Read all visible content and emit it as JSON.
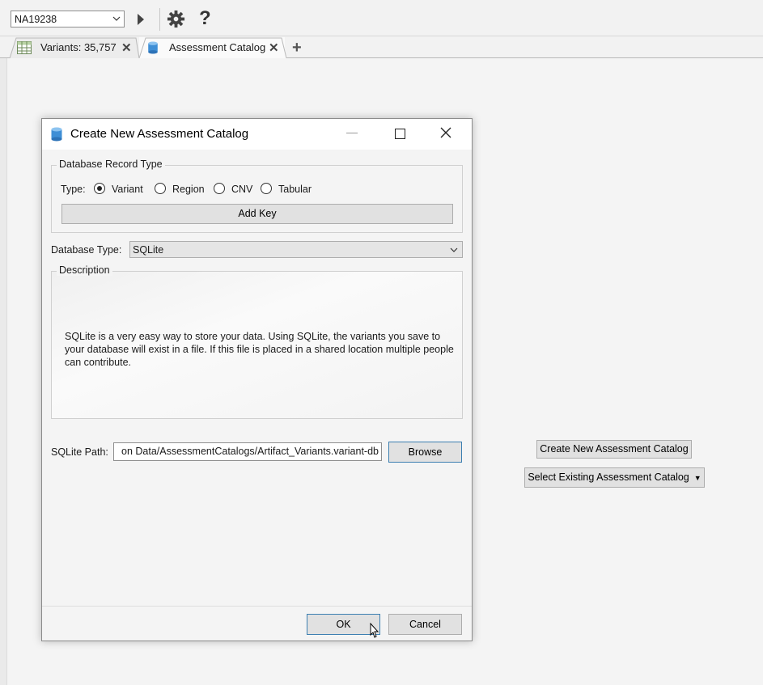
{
  "toolbar": {
    "sample_value": "NA19238",
    "icons": [
      "play-icon",
      "gear-icon",
      "help-icon"
    ],
    "help_label": "?"
  },
  "tabs": [
    {
      "label": "Variants: 35,757",
      "icon": "table-icon"
    },
    {
      "label": "Assessment Catalog",
      "icon": "database-icon",
      "active": true
    }
  ],
  "tab_add_label": "+",
  "main": {
    "create_button": "Create New Assessment Catalog",
    "select_button": "Select Existing Assessment Catalog"
  },
  "dialog": {
    "title": "Create New Assessment Catalog",
    "record_group": {
      "legend": "Database Record Type",
      "type_label": "Type:",
      "options": [
        "Variant",
        "Region",
        "CNV",
        "Tabular"
      ],
      "selected": "Variant",
      "add_key_label": "Add Key"
    },
    "db_type": {
      "label": "Database Type:",
      "value": "SQLite"
    },
    "description": {
      "legend": "Description",
      "text": "SQLite is a very easy way to store your data. Using SQLite, the variants you save to your database will exist in a file. If this file is placed in a shared location multiple people can contribute."
    },
    "path": {
      "label": "SQLite Path:",
      "value": "on Data/AssessmentCatalogs/Artifact_Variants.variant-db",
      "browse_label": "Browse"
    },
    "ok_label": "OK",
    "cancel_label": "Cancel"
  },
  "colors": {
    "focus_border": "#3c7fb1",
    "button_bg": "#e1e1e1",
    "window_bg": "#f4f4f4"
  }
}
